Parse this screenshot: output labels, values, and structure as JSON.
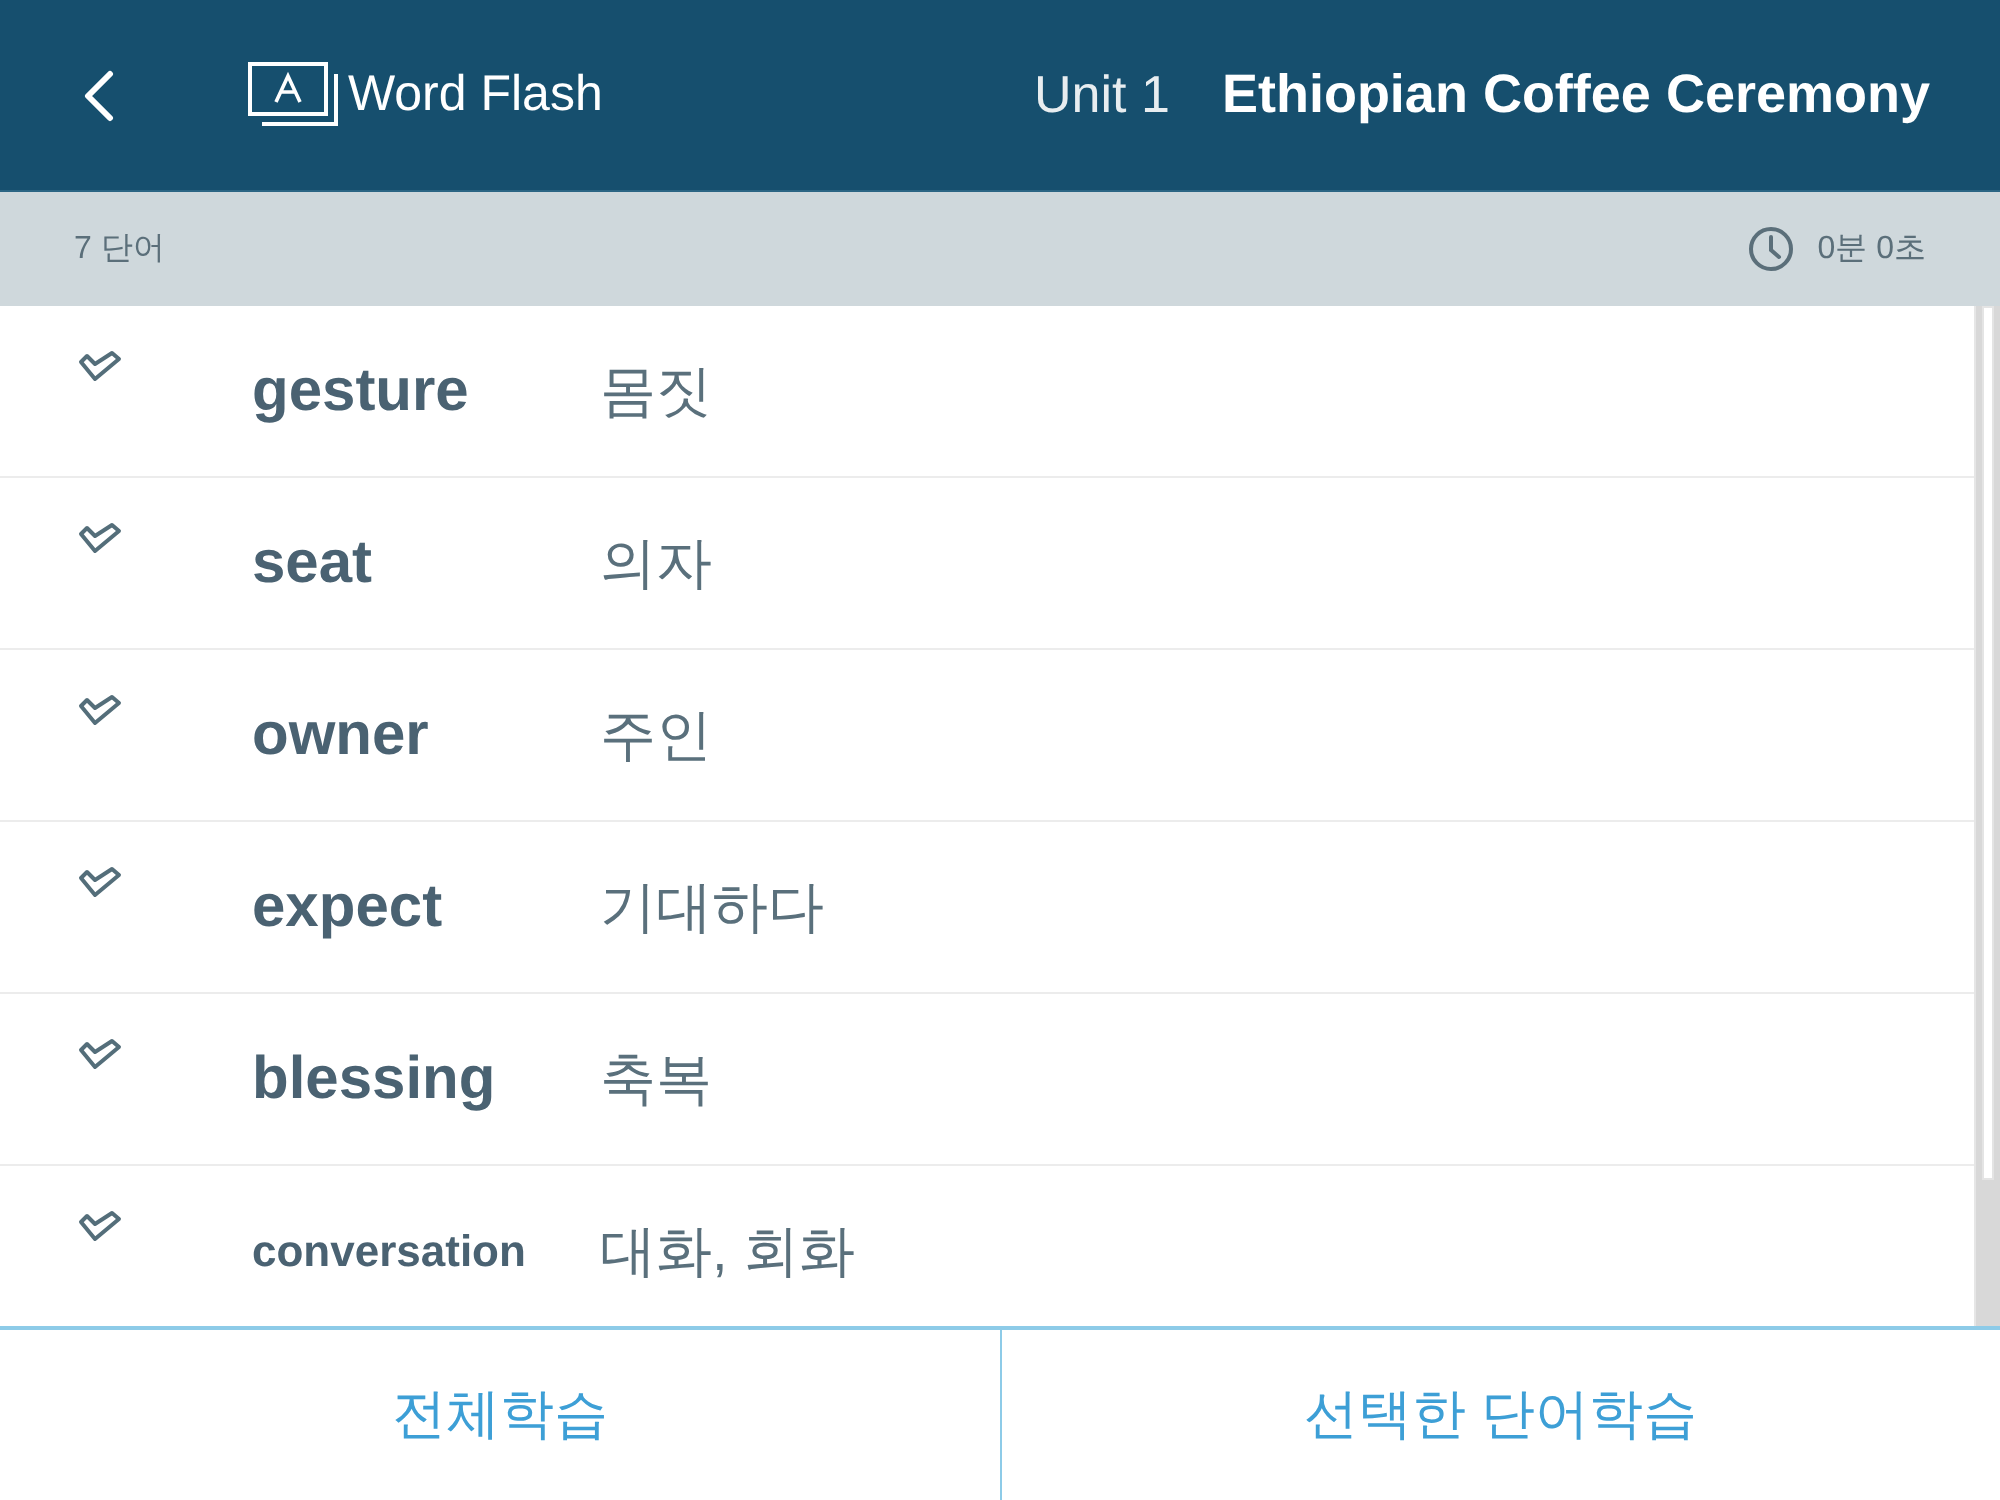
{
  "header": {
    "title": "Word Flash",
    "unit": "Unit 1",
    "lesson": "Ethiopian Coffee Ceremony"
  },
  "summary": {
    "word_count": "7 단어",
    "elapsed_time": "0분 0초"
  },
  "words": [
    {
      "word": "gesture",
      "meaning": "몸짓",
      "checked": false
    },
    {
      "word": "seat",
      "meaning": "의자",
      "checked": false
    },
    {
      "word": "owner",
      "meaning": "주인",
      "checked": false
    },
    {
      "word": "expect",
      "meaning": "기대하다",
      "checked": false
    },
    {
      "word": "blessing",
      "meaning": "축복",
      "checked": false
    },
    {
      "word": "conversation",
      "meaning": "대화, 회화",
      "checked": false
    }
  ],
  "buttons": [
    "전체학습",
    "선택한 단어학습"
  ]
}
